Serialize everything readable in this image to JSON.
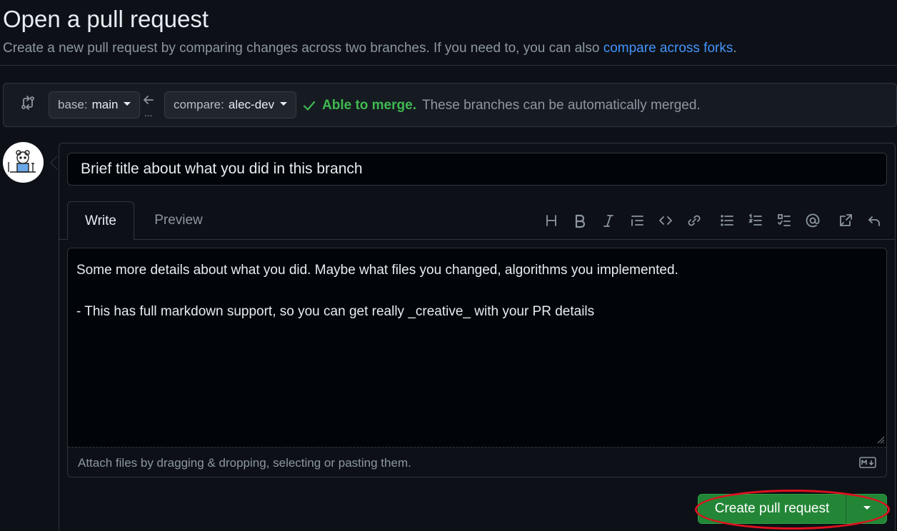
{
  "header": {
    "title": "Open a pull request",
    "subtitle_prefix": "Create a new pull request by comparing changes across two branches. If you need to, you can also ",
    "subtitle_link": "compare across forks",
    "subtitle_suffix": "."
  },
  "compare": {
    "base_prefix": "base:",
    "base_branch": "main",
    "compare_prefix": "compare:",
    "compare_branch": "alec-dev",
    "dots": "...",
    "merge_ok": "Able to merge.",
    "merge_text": "These branches can be automatically merged."
  },
  "form": {
    "title_value": "Brief title about what you did in this branch",
    "tabs": [
      {
        "label": "Write",
        "active": true
      },
      {
        "label": "Preview",
        "active": false
      }
    ],
    "toolbar_icons": [
      "heading-icon",
      "bold-icon",
      "italic-icon",
      "quote-icon",
      "code-icon",
      "link-icon",
      "unordered-list-icon",
      "ordered-list-icon",
      "task-list-icon",
      "mention-icon",
      "reference-icon",
      "undo-icon"
    ],
    "body_value": "Some more details about what you did. Maybe what files you changed, algorithms you implemented.\n\n- This has full markdown support, so you can get really _creative_ with your PR details",
    "attach_text": "Attach files by dragging & dropping, selecting or pasting them."
  },
  "actions": {
    "create_label": "Create pull request"
  },
  "colors": {
    "background": "#0d1117",
    "accent_link": "#4493f8",
    "merge_ok": "#3fb950",
    "primary_button": "#238636",
    "highlight": "#e0101e"
  }
}
